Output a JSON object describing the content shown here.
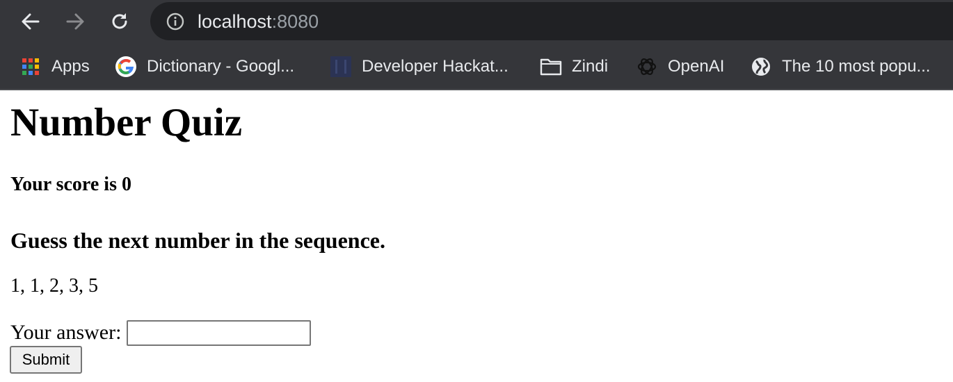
{
  "browser": {
    "url_host": "localhost",
    "url_port": ":8080",
    "icons": {
      "back": "arrow-left-icon",
      "forward": "arrow-right-icon",
      "reload": "reload-icon",
      "site_info": "info-icon"
    }
  },
  "bookmarks": [
    {
      "label": "Apps",
      "icon": "apps-grid-icon"
    },
    {
      "label": "Dictionary - Googl...",
      "icon": "google-icon"
    },
    {
      "label": "Developer Hackat...",
      "icon": "site-favicon-icon"
    },
    {
      "label": "Zindi",
      "icon": "folder-icon"
    },
    {
      "label": "OpenAI",
      "icon": "openai-icon"
    },
    {
      "label": "The 10 most popu...",
      "icon": "globe-icon"
    }
  ],
  "page": {
    "title": "Number Quiz",
    "score_text": "Your score is 0",
    "instruction": "Guess the next number in the sequence.",
    "sequence": "1, 1, 2, 3, 5",
    "answer_label": "Your answer:",
    "answer_value": "",
    "submit_label": "Submit"
  },
  "colors": {
    "chrome_bg": "#35363a",
    "omnibox_bg": "#202124",
    "chrome_text": "#e8eaed",
    "port_text": "#9aa0a6"
  }
}
